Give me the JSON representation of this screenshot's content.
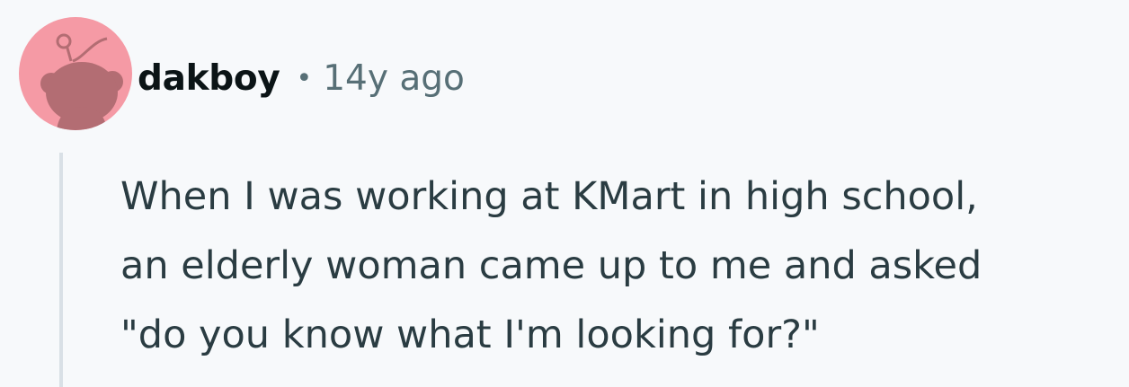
{
  "comment": {
    "author": "dakboy",
    "separator": "•",
    "age": "14y ago",
    "avatar_icon": "reddit-snoo-avatar-icon",
    "avatar_background": "#f59aa5",
    "avatar_figure_color": "#b36d73",
    "text": "When I was working at KMart in high school,\nan elderly woman came up to me and asked\n\"do you know what I'm looking for?\""
  }
}
